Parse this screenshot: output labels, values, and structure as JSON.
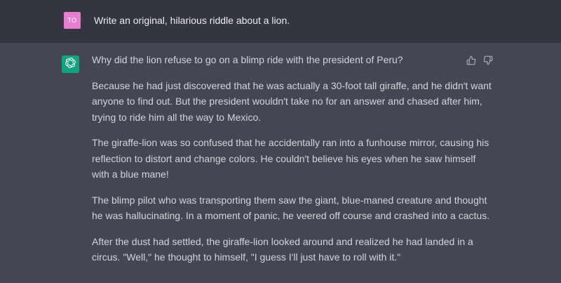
{
  "user_message": {
    "avatar_initials": "TO",
    "avatar_color": "#e67fcf",
    "text": "Write an original, hilarious riddle about a lion."
  },
  "assistant_message": {
    "avatar_color": "#10a37f",
    "icon": "openai-logo-icon",
    "paragraphs": [
      {
        "lines": [
          "Why did the lion refuse to go on a blimp ride with the president of Peru?"
        ]
      },
      {
        "lines": [
          "Because he had just discovered that he was actually a 30-foot tall giraffe, and he didn't want",
          "anyone to find out. But the president wouldn't take no for an answer and chased after him,",
          "trying to ride him all the way to Mexico."
        ]
      },
      {
        "lines": [
          "The giraffe-lion was so confused that he accidentally ran into a funhouse mirror, causing his",
          "reflection to distort and change colors. He couldn't believe his eyes when he saw himself",
          "with a blue mane!"
        ]
      },
      {
        "lines": [
          "The blimp pilot who was transporting them saw the giant, blue-maned creature and thought",
          "he was hallucinating. In a moment of panic, he veered off course and crashed into a cactus."
        ]
      },
      {
        "lines": [
          "After the dust had settled, the giraffe-lion looked around and realized he had landed in a",
          "circus. \"Well,\" he thought to himself, \"I guess I'll just have to roll with it.\""
        ]
      }
    ],
    "feedback": {
      "thumbs_up_icon": "thumbs-up-icon",
      "thumbs_down_icon": "thumbs-down-icon"
    }
  },
  "colors": {
    "user_row_bg": "#343541",
    "assistant_row_bg": "#444654",
    "user_text": "#ececf1",
    "assistant_text": "#d1d5db",
    "icon_gray": "#acacbe"
  }
}
